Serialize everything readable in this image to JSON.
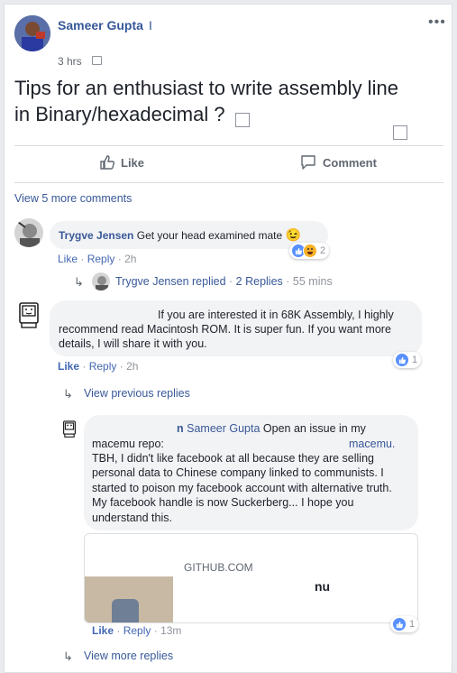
{
  "post": {
    "author": "Sameer Gupta",
    "time": "3 hrs",
    "text_line1": "Tips for an enthusiast to write assembly line",
    "text_line2": "in Binary/hexadecimal ?",
    "more_icon": "more-options-icon"
  },
  "actions": {
    "like_label": "Like",
    "comment_label": "Comment"
  },
  "comments_link": "View 5 more comments",
  "comment1": {
    "author": "Trygve Jensen",
    "text": "Get your head examined mate",
    "emoji": "😉",
    "like_action": "Like",
    "reply_action": "Reply",
    "time": "2h",
    "reactions_count": "2"
  },
  "reply_summary": {
    "author": "Trygve Jensen",
    "replied": "replied",
    "count": "2 Replies",
    "time": "55 mins"
  },
  "comment2": {
    "line1": "If you are interested it in 68K Assembly, I highly",
    "line2": "recommend read Macintosh ROM. It is super fun. If you want more",
    "line3": "details, I will share it with you.",
    "like_action": "Like",
    "reply_action": "Reply",
    "time": "2h",
    "reactions_count": "1"
  },
  "previous_replies": "View previous replies",
  "reply1": {
    "name_suffix": "n",
    "mention": "Sameer Gupta",
    "line1": "Open an issue in my",
    "line2_prefix": "macemu repo:",
    "line2_link": "macemu.",
    "line3": "TBH, I didn't like facebook at all because they are selling",
    "line4": "personal data to Chinese company linked to communists. I",
    "line5": "started to poison my facebook account with alternative truth.",
    "line6": "My facebook handle is now Suckerberg... I hope you",
    "line7": "understand this.",
    "preview_domain": "GITHUB.COM",
    "preview_title_tail": "nu",
    "like_action": "Like",
    "reply_action": "Reply",
    "time": "13m",
    "reactions_count": "1"
  },
  "more_replies": "View more replies",
  "colors": {
    "link": "#385898",
    "blue": "#4267b2",
    "muted": "#90949c",
    "bubble": "#f2f3f5"
  }
}
